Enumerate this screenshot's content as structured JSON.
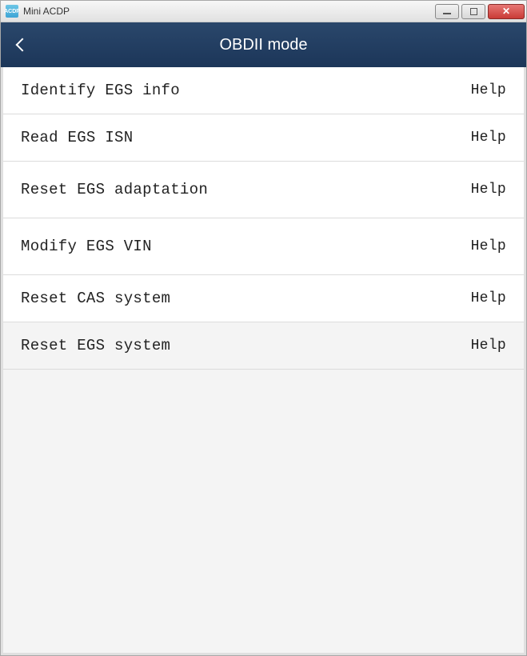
{
  "window": {
    "title": "Mini ACDP"
  },
  "header": {
    "title": "OBDII mode"
  },
  "menu": {
    "help_label": "Help",
    "items": [
      {
        "label": "Identify EGS info"
      },
      {
        "label": "Read EGS ISN"
      },
      {
        "label": "Reset EGS adaptation"
      },
      {
        "label": "Modify EGS VIN"
      },
      {
        "label": "Reset CAS system"
      },
      {
        "label": "Reset EGS system"
      }
    ]
  }
}
